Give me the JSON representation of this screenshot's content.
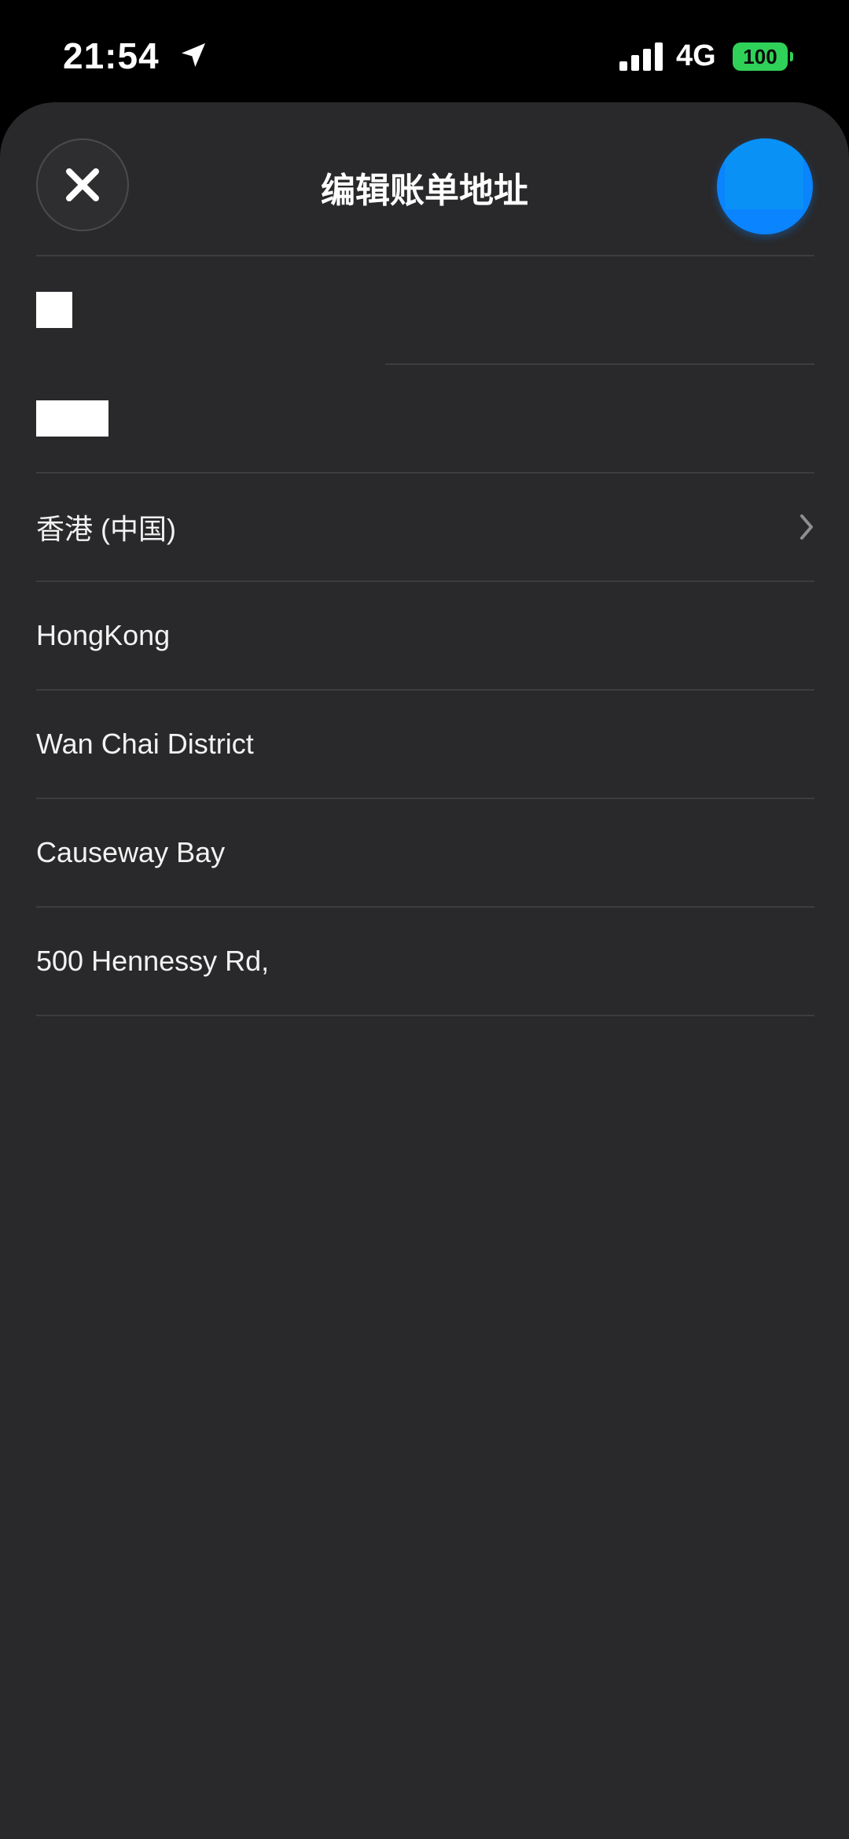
{
  "status_bar": {
    "time": "21:54",
    "location_icon": "location-arrow-icon",
    "signal_icon": "cellular-signal-icon",
    "network": "4G",
    "battery": "100"
  },
  "header": {
    "title": "编辑账单地址",
    "close_icon": "close-icon",
    "done_button_color": "#0a84ff"
  },
  "form": {
    "first_name": "",
    "last_name": "",
    "country": "香港 (中国)",
    "city": "HongKong",
    "district": "Wan Chai District",
    "area": "Causeway Bay",
    "street": "500 Hennessy Rd,"
  },
  "colors": {
    "sheet_background": "#29292b",
    "accent": "#0a84ff",
    "battery": "#30d158"
  }
}
